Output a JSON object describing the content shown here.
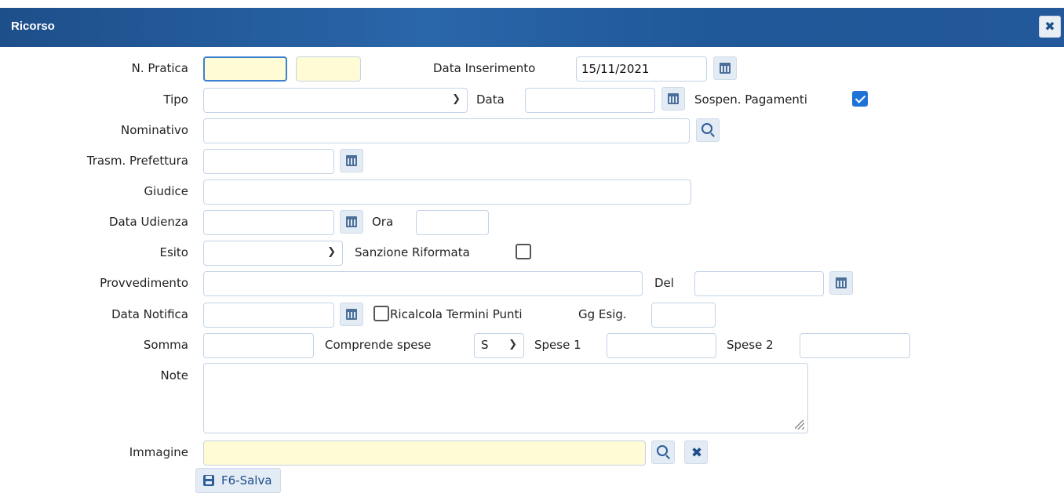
{
  "window": {
    "title": "Ricorso",
    "close_icon": "close-icon"
  },
  "form": {
    "n_pratica": {
      "label": "N. Pratica",
      "value1": "",
      "value2": ""
    },
    "data_inserimento": {
      "label": "Data Inserimento",
      "value": "15/11/2021"
    },
    "tipo": {
      "label": "Tipo",
      "value": ""
    },
    "data": {
      "label": "Data",
      "value": ""
    },
    "sospen_pagamenti": {
      "label": "Sospen. Pagamenti",
      "checked": true
    },
    "nominativo": {
      "label": "Nominativo",
      "value": ""
    },
    "trasm_prefettura": {
      "label": "Trasm. Prefettura",
      "value": ""
    },
    "giudice": {
      "label": "Giudice",
      "value": ""
    },
    "data_udienza": {
      "label": "Data Udienza",
      "value": ""
    },
    "ora": {
      "label": "Ora",
      "value": ""
    },
    "esito": {
      "label": "Esito",
      "value": ""
    },
    "sanzione_riformata": {
      "label": "Sanzione Riformata",
      "checked": false
    },
    "provvedimento": {
      "label": "Provvedimento",
      "value": ""
    },
    "del": {
      "label": "Del",
      "value": ""
    },
    "data_notifica": {
      "label": "Data Notifica",
      "value": ""
    },
    "ricalcola": {
      "label": "Ricalcola Termini Punti",
      "checked": false
    },
    "gg_esig": {
      "label": "Gg Esig.",
      "value": ""
    },
    "somma": {
      "label": "Somma",
      "value": ""
    },
    "comprende_spese": {
      "label": "Comprende spese",
      "value": "S"
    },
    "spese1": {
      "label": "Spese 1",
      "value": ""
    },
    "spese2": {
      "label": "Spese 2",
      "value": ""
    },
    "note": {
      "label": "Note",
      "value": ""
    },
    "immagine": {
      "label": "Immagine",
      "value": ""
    }
  },
  "actions": {
    "save_label": "F6-Salva"
  },
  "colors": {
    "titlebar": "#1d4f8a",
    "accent": "#1f73d6",
    "required_field": "#fffbd4"
  }
}
